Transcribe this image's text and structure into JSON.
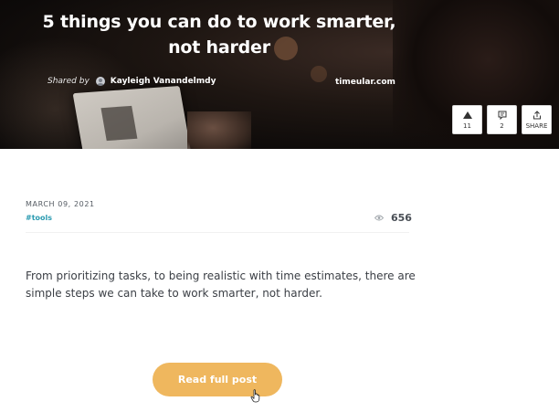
{
  "hero": {
    "title": "5 things you can do to work smarter, not harder",
    "shared_by_label": "Shared by",
    "author": "Kayleigh Vanandelmdy",
    "source": "timeular.com"
  },
  "actions": {
    "upvote": {
      "icon": "triangle-up-icon",
      "count": "11"
    },
    "comments": {
      "icon": "comment-icon",
      "count": "2"
    },
    "share": {
      "icon": "share-icon",
      "label": "SHARE"
    }
  },
  "meta": {
    "date": "MARCH 09, 2021",
    "tag": "#tools",
    "views": "656",
    "views_icon": "eye-icon"
  },
  "excerpt": "From prioritizing tasks, to being realistic with time estimates, there are simple steps we can take to work smarter, not harder.",
  "read_button": {
    "label": "Read full post"
  },
  "colors": {
    "accent_button": "#efb75e",
    "tag": "#2b9bb1",
    "hero_bg": "#0d0a09"
  }
}
